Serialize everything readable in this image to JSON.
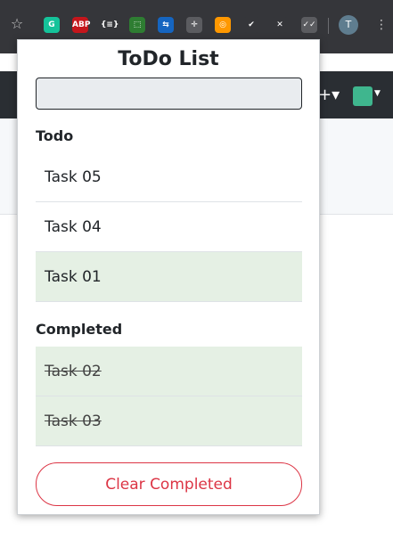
{
  "browser": {
    "profile_initial": "T",
    "extensions": [
      {
        "icon": "grammarly-icon",
        "label": "G",
        "color": "#15c39a"
      },
      {
        "icon": "adblock-plus-icon",
        "label": "ABP",
        "color": "#c4161c"
      },
      {
        "icon": "json-formatter-icon",
        "label": "{≡}",
        "color": "#35363a"
      },
      {
        "icon": "screenshot-icon",
        "label": "⬚",
        "color": "#2e7d32"
      },
      {
        "icon": "sync-icon",
        "label": "⇆",
        "color": "#1565c0"
      },
      {
        "icon": "ruler-icon",
        "label": "✛",
        "color": "#5b5c60"
      },
      {
        "icon": "color-picker-icon",
        "label": "◎",
        "color": "#ff9800"
      },
      {
        "icon": "checkmark-icon",
        "label": "✔",
        "color": "#35363a"
      },
      {
        "icon": "x-extension-icon",
        "label": "✕",
        "color": "#35363a"
      },
      {
        "icon": "todo-extension-icon",
        "label": "✓✓",
        "color": "#5b5c60"
      }
    ]
  },
  "popup": {
    "title": "ToDo List",
    "input": {
      "value": "",
      "placeholder": ""
    },
    "todo_label": "Todo",
    "todo_items": [
      {
        "label": "Task 05",
        "highlighted": false
      },
      {
        "label": "Task 04",
        "highlighted": false
      },
      {
        "label": "Task 01",
        "highlighted": true
      }
    ],
    "completed_label": "Completed",
    "completed_items": [
      {
        "label": "Task 02"
      },
      {
        "label": "Task 03"
      }
    ],
    "clear_button_label": "Clear Completed"
  },
  "colors": {
    "accent_danger": "#dc3545",
    "highlight": "#e5f0e4"
  }
}
